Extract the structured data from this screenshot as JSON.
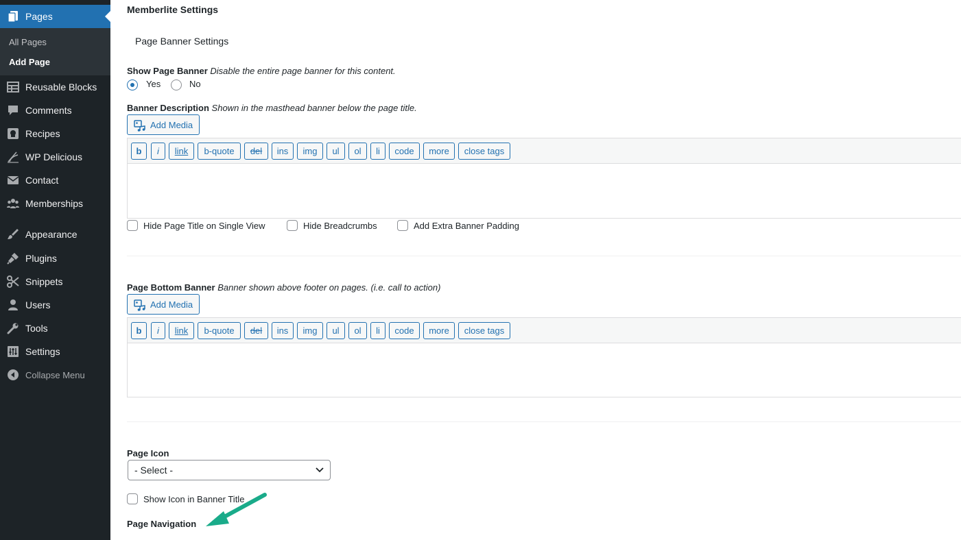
{
  "sidebar": {
    "active": {
      "label": "Pages",
      "icon": "pages-icon"
    },
    "submenu": [
      {
        "label": "All Pages"
      },
      {
        "label": "Add Page"
      }
    ],
    "items": [
      {
        "label": "Reusable Blocks",
        "icon": "reusable-blocks-icon"
      },
      {
        "label": "Comments",
        "icon": "comments-icon"
      },
      {
        "label": "Recipes",
        "icon": "recipes-icon"
      },
      {
        "label": "WP Delicious",
        "icon": "wp-delicious-icon"
      },
      {
        "label": "Contact",
        "icon": "contact-icon"
      },
      {
        "label": "Memberships",
        "icon": "memberships-icon"
      },
      {
        "label": "Appearance",
        "icon": "appearance-icon"
      },
      {
        "label": "Plugins",
        "icon": "plugins-icon"
      },
      {
        "label": "Snippets",
        "icon": "snippets-icon"
      },
      {
        "label": "Users",
        "icon": "users-icon"
      },
      {
        "label": "Tools",
        "icon": "tools-icon"
      },
      {
        "label": "Settings",
        "icon": "settings-icon"
      },
      {
        "label": "Collapse Menu",
        "icon": "collapse-icon"
      }
    ]
  },
  "main": {
    "section_title": "Memberlite Settings",
    "subsection_title": "Page Banner Settings",
    "show_banner": {
      "label": "Show Page Banner",
      "description": "Disable the entire page banner for this content.",
      "options": [
        "Yes",
        "No"
      ],
      "selected": "Yes"
    },
    "banner_description": {
      "label": "Banner Description",
      "description": "Shown in the masthead banner below the page title.",
      "add_media": "Add Media"
    },
    "quicktags": [
      "b",
      "i",
      "link",
      "b-quote",
      "del",
      "ins",
      "img",
      "ul",
      "ol",
      "li",
      "code",
      "more",
      "close tags"
    ],
    "checkboxes": [
      "Hide Page Title on Single View",
      "Hide Breadcrumbs",
      "Add Extra Banner Padding"
    ],
    "bottom_banner": {
      "label": "Page Bottom Banner",
      "description": "Banner shown above footer on pages. (i.e. call to action)",
      "add_media": "Add Media"
    },
    "page_icon": {
      "label": "Page Icon",
      "selected": "- Select -"
    },
    "show_icon_checkbox": "Show Icon in Banner Title",
    "page_navigation": "Page Navigation"
  },
  "colors": {
    "sidebar_bg": "#1d2327",
    "active_bg": "#2271b1",
    "accent": "#2271b1",
    "annotation_arrow": "#1aab8a"
  }
}
